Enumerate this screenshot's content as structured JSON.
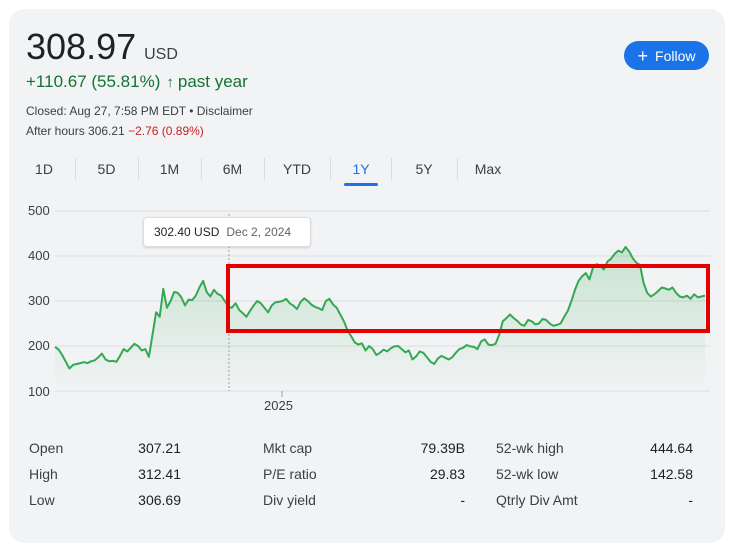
{
  "quote": {
    "price": "308.97",
    "currency": "USD",
    "change": "+110.67 (55.81%)",
    "change_arrow": "↑",
    "period": "past year",
    "closed_text": "Closed: Aug 27, 7:58 PM EDT",
    "separator": "•",
    "disclaimer": "Disclaimer",
    "after_hours_label": "After hours 306.21",
    "after_hours_change": "−2.76 (0.89%)"
  },
  "follow_button": {
    "label": "Follow",
    "icon": "plus-icon"
  },
  "tabs": [
    {
      "label": "1D",
      "active": false
    },
    {
      "label": "5D",
      "active": false
    },
    {
      "label": "1M",
      "active": false
    },
    {
      "label": "6M",
      "active": false
    },
    {
      "label": "YTD",
      "active": false
    },
    {
      "label": "1Y",
      "active": true
    },
    {
      "label": "5Y",
      "active": false
    },
    {
      "label": "Max",
      "active": false
    }
  ],
  "tooltip": {
    "value": "302.40 USD",
    "date": "Dec 2, 2024"
  },
  "chart_data": {
    "type": "area",
    "y_ticks": [
      "500",
      "400",
      "300",
      "200",
      "100"
    ],
    "x_ticks": [
      "2025"
    ],
    "ylim": [
      100,
      500
    ],
    "color": "#34a853",
    "values": [
      198,
      192,
      180,
      165,
      150,
      158,
      160,
      162,
      164,
      162,
      166,
      168,
      175,
      183,
      170,
      166,
      167,
      165,
      178,
      193,
      188,
      196,
      205,
      200,
      190,
      193,
      176,
      225,
      275,
      265,
      327,
      285,
      300,
      320,
      318,
      308,
      290,
      303,
      302,
      312,
      330,
      345,
      320,
      310,
      325,
      316,
      312,
      300,
      288,
      285,
      295,
      280,
      273,
      265,
      278,
      290,
      300,
      295,
      285,
      275,
      290,
      297,
      298,
      300,
      305,
      295,
      290,
      282,
      298,
      306,
      300,
      292,
      287,
      284,
      280,
      300,
      305,
      292,
      285,
      270,
      255,
      235,
      222,
      208,
      203,
      206,
      190,
      200,
      193,
      180,
      185,
      192,
      188,
      195,
      199,
      200,
      193,
      186,
      190,
      170,
      177,
      188,
      185,
      175,
      165,
      160,
      172,
      178,
      174,
      170,
      175,
      185,
      193,
      196,
      202,
      199,
      198,
      193,
      210,
      215,
      203,
      202,
      205,
      225,
      255,
      262,
      270,
      262,
      256,
      248,
      245,
      258,
      255,
      248,
      250,
      260,
      258,
      250,
      245,
      247,
      250,
      265,
      278,
      300,
      325,
      345,
      355,
      362,
      348,
      375,
      382,
      378,
      370,
      388,
      394,
      405,
      412,
      408,
      420,
      410,
      395,
      385,
      380,
      340,
      318,
      310,
      315,
      322,
      330,
      328,
      325,
      330,
      318,
      310,
      308,
      312,
      305,
      315,
      308,
      310,
      312
    ]
  },
  "stats": [
    [
      {
        "label": "Open",
        "value": "307.21"
      },
      {
        "label": "Mkt cap",
        "value": "79.39B"
      },
      {
        "label": "52-wk high",
        "value": "444.64"
      }
    ],
    [
      {
        "label": "High",
        "value": "312.41"
      },
      {
        "label": "P/E ratio",
        "value": "29.83"
      },
      {
        "label": "52-wk low",
        "value": "142.58"
      }
    ],
    [
      {
        "label": "Low",
        "value": "306.69"
      },
      {
        "label": "Div yield",
        "value": "-"
      },
      {
        "label": "Qtrly Div Amt",
        "value": "-"
      }
    ]
  ]
}
